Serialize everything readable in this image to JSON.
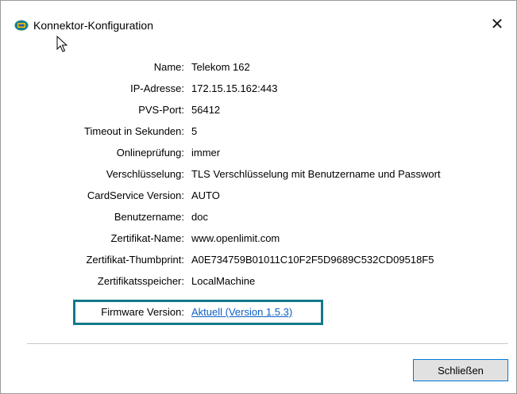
{
  "window": {
    "title": "Konnektor-Konfiguration",
    "close_glyph": "✕"
  },
  "details": [
    {
      "label": "Name:",
      "value": "Telekom 162"
    },
    {
      "label": "IP-Adresse:",
      "value": "172.15.15.162:443"
    },
    {
      "label": "PVS-Port:",
      "value": "56412"
    },
    {
      "label": "Timeout in Sekunden:",
      "value": "5"
    },
    {
      "label": "Onlineprüfung:",
      "value": "immer"
    },
    {
      "label": "Verschlüsselung:",
      "value": "TLS Verschlüsselung mit Benutzername und Passwort"
    },
    {
      "label": "CardService Version:",
      "value": "AUTO"
    },
    {
      "label": "Benutzername:",
      "value": "doc"
    },
    {
      "label": "Zertifikat-Name:",
      "value": "www.openlimit.com"
    },
    {
      "label": "Zertifikat-Thumbprint:",
      "value": "A0E734759B01011C10F2F5D9689C532CD09518F5"
    },
    {
      "label": "Zertifikatsspeicher:",
      "value": "LocalMachine"
    },
    {
      "label": "Firmware Version:",
      "value": "Aktuell (Version 1.5.3)"
    }
  ],
  "buttons": {
    "close_label": "Schließen"
  },
  "colors": {
    "highlight_border": "#12798a",
    "link": "#0d5fc4",
    "button_border": "#0078d7"
  },
  "icons": {
    "app": "connector-app-icon",
    "close": "close-icon",
    "cursor": "mouse-cursor-icon"
  }
}
